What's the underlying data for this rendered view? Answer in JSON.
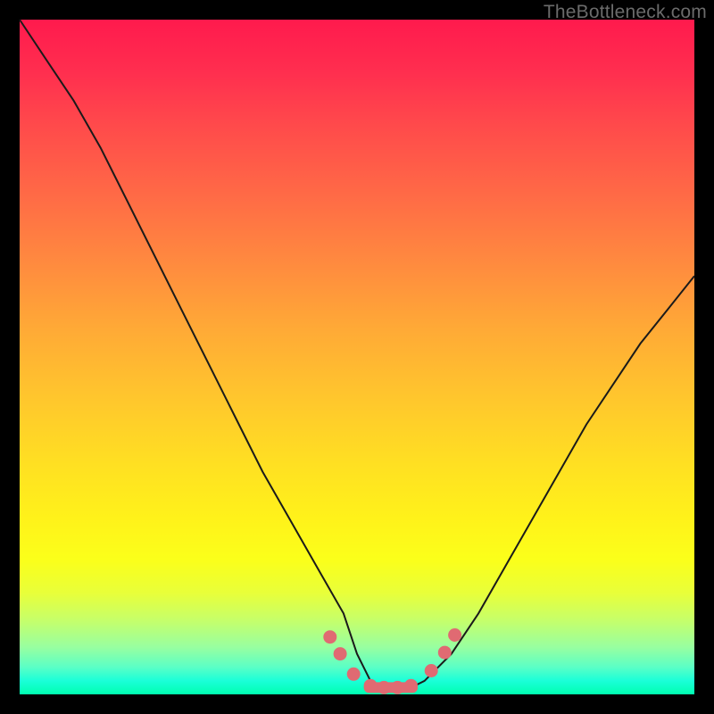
{
  "watermark": "TheBottleneck.com",
  "chart_data": {
    "type": "line",
    "title": "",
    "xlabel": "",
    "ylabel": "",
    "xlim": [
      0,
      100
    ],
    "ylim": [
      0,
      100
    ],
    "series": [
      {
        "name": "curve",
        "x": [
          0,
          4,
          8,
          12,
          16,
          20,
          24,
          28,
          32,
          36,
          40,
          44,
          48,
          50,
          52,
          54,
          56,
          58,
          60,
          64,
          68,
          72,
          76,
          80,
          84,
          88,
          92,
          96,
          100
        ],
        "y": [
          100,
          94,
          88,
          81,
          73,
          65,
          57,
          49,
          41,
          33,
          26,
          19,
          12,
          6,
          2,
          1,
          1,
          1,
          2,
          6,
          12,
          19,
          26,
          33,
          40,
          46,
          52,
          57,
          62
        ]
      }
    ],
    "markers": [
      {
        "x": 46.0,
        "y": 8.5
      },
      {
        "x": 47.5,
        "y": 6.0
      },
      {
        "x": 49.5,
        "y": 3.0
      },
      {
        "x": 52.0,
        "y": 1.3
      },
      {
        "x": 54.0,
        "y": 1.0
      },
      {
        "x": 56.0,
        "y": 1.0
      },
      {
        "x": 58.0,
        "y": 1.3
      },
      {
        "x": 61.0,
        "y": 3.5
      },
      {
        "x": 63.0,
        "y": 6.2
      },
      {
        "x": 64.5,
        "y": 8.8
      }
    ],
    "plateau_bar": {
      "x0": 51,
      "x1": 59,
      "y": 1.0
    },
    "marker_color": "#e06a72",
    "curve_color": "#1a1a1a"
  }
}
